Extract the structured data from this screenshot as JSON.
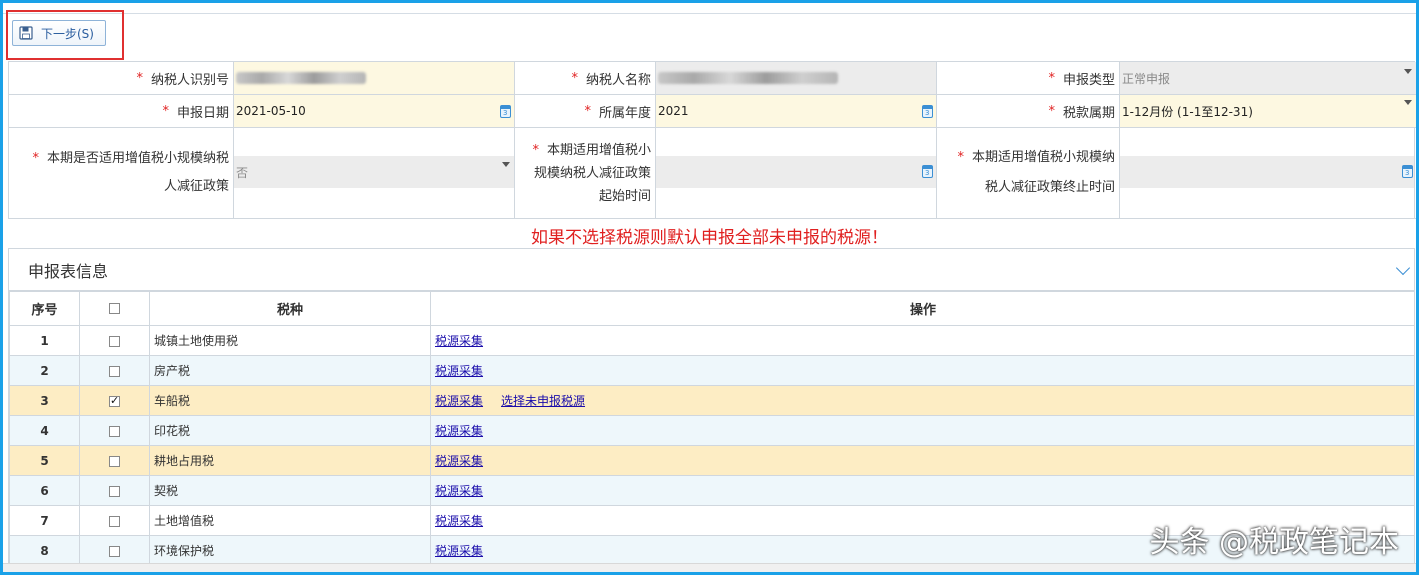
{
  "toolbar": {
    "next_label": "下一步(S)"
  },
  "form": {
    "taxpayer_id": {
      "label": "纳税人识别号",
      "value": ""
    },
    "taxpayer_name": {
      "label": "纳税人名称",
      "value": ""
    },
    "declare_type": {
      "label": "申报类型",
      "value": "正常申报"
    },
    "declare_date": {
      "label": "申报日期",
      "value": "2021-05-10"
    },
    "year": {
      "label": "所属年度",
      "value": "2021"
    },
    "period": {
      "label": "税款属期",
      "value": "1-12月份  (1-1至12-31)"
    },
    "small_scale": {
      "label_line1": "本期是否适用增值税小规模纳税",
      "label_line2": "人减征政策",
      "value": "否"
    },
    "policy_start": {
      "label_line1": "本期适用增值税小",
      "label_line2": "规模纳税人减征政策",
      "label_line3": "起始时间",
      "value": ""
    },
    "policy_end": {
      "label_line1": "本期适用增值税小规模纳",
      "label_line2": "税人减征政策终止时间",
      "value": ""
    }
  },
  "warning": "如果不选择税源则默认申报全部未申报的税源！",
  "panel": {
    "title": "申报表信息",
    "columns": {
      "seq": "序号",
      "tax": "税种",
      "ops": "操作"
    },
    "rows": [
      {
        "seq": "1",
        "tax": "城镇土地使用税",
        "checked": false,
        "ops": [
          "税源采集"
        ]
      },
      {
        "seq": "2",
        "tax": "房产税",
        "checked": false,
        "ops": [
          "税源采集"
        ]
      },
      {
        "seq": "3",
        "tax": "车船税",
        "checked": true,
        "ops": [
          "税源采集",
          "选择未申报税源"
        ]
      },
      {
        "seq": "4",
        "tax": "印花税",
        "checked": false,
        "ops": [
          "税源采集"
        ]
      },
      {
        "seq": "5",
        "tax": "耕地占用税",
        "checked": false,
        "ops": [
          "税源采集"
        ]
      },
      {
        "seq": "6",
        "tax": "契税",
        "checked": false,
        "ops": [
          "税源采集"
        ]
      },
      {
        "seq": "7",
        "tax": "土地增值税",
        "checked": false,
        "ops": [
          "税源采集"
        ]
      },
      {
        "seq": "8",
        "tax": "环境保护税",
        "checked": false,
        "ops": [
          "税源采集"
        ]
      }
    ]
  },
  "watermark": "头条 @税政笔记本",
  "colors": {
    "accent": "#1aa1e8",
    "warning": "#e02020",
    "highlight_row": "#fdedc4",
    "input_bg": "#fdf8e1"
  }
}
